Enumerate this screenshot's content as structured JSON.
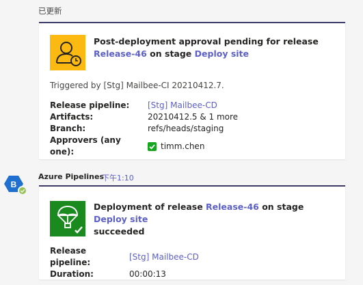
{
  "updated_label": "已更新",
  "card1": {
    "title_prefix": "Post-deployment approval pending for release",
    "release_link": "Release-46",
    "stage_word": "on stage",
    "stage_link": "Deploy site",
    "triggered_text": "Triggered by [Stg] Mailbee-CI 20210412.7.",
    "facts": {
      "pipeline_key": "Release pipeline:",
      "pipeline_val": "[Stg] Mailbee-CD",
      "artifacts_key": "Artifacts:",
      "artifacts_val": "20210412.5 & 1 more",
      "branch_key": "Branch:",
      "branch_val": "refs/heads/staging",
      "approvers_key": "Approvers (any one):",
      "approvers_val": "timm.chen"
    },
    "icon": "user-clock-icon",
    "accent_color": "#fbb911"
  },
  "message": {
    "avatar_letter": "B",
    "sender": "Azure Pipelines",
    "time": "下午1:10"
  },
  "card2": {
    "title_prefix": "Deployment of release",
    "release_link": "Release-46",
    "stage_word": "on stage",
    "stage_link": "Deploy site",
    "title_suffix": "succeeded",
    "facts": {
      "pipeline_key": "Release pipeline:",
      "pipeline_val": "[Stg] Mailbee-CD",
      "duration_key": "Duration:",
      "duration_val": "00:00:13"
    },
    "icon": "parachute-check-icon",
    "accent_color": "#1b8a1e"
  }
}
